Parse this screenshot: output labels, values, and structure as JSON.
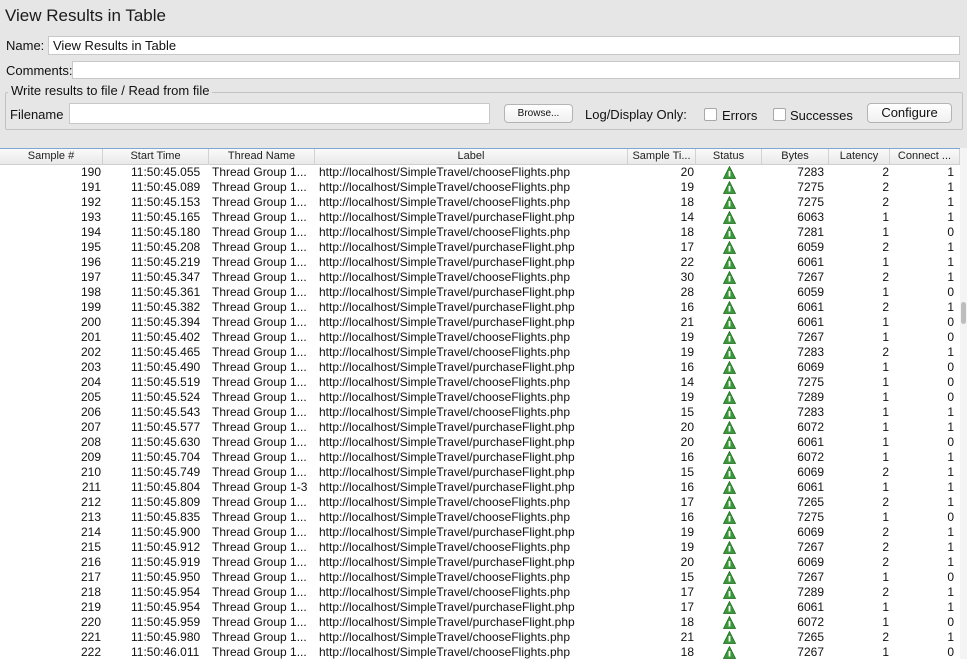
{
  "window": {
    "title": "View Results in Table"
  },
  "form": {
    "name_label": "Name:",
    "name_value": "View Results in Table",
    "comments_label": "Comments:",
    "comments_value": "",
    "group_title": "Write results to file / Read from file",
    "filename_label": "Filename",
    "filename_value": "",
    "browse_label": "Browse...",
    "logdisplay_label": "Log/Display Only:",
    "errors_label": "Errors",
    "successes_label": "Successes",
    "configure_label": "Configure"
  },
  "table": {
    "columns": [
      "Sample #",
      "Start Time",
      "Thread Name",
      "Label",
      "Sample Ti...",
      "Status",
      "Bytes",
      "Latency",
      "Connect ..."
    ],
    "status_icon": "success-triangle-icon",
    "status_color": "#3a9a3a",
    "rows": [
      [
        "190",
        "11:50:45.055",
        "Thread Group 1...",
        "http://localhost/SimpleTravel/chooseFlights.php",
        "20",
        "7283",
        "2",
        "1"
      ],
      [
        "191",
        "11:50:45.089",
        "Thread Group 1...",
        "http://localhost/SimpleTravel/chooseFlights.php",
        "19",
        "7275",
        "2",
        "1"
      ],
      [
        "192",
        "11:50:45.153",
        "Thread Group 1...",
        "http://localhost/SimpleTravel/chooseFlights.php",
        "18",
        "7275",
        "2",
        "1"
      ],
      [
        "193",
        "11:50:45.165",
        "Thread Group 1...",
        "http://localhost/SimpleTravel/purchaseFlight.php",
        "14",
        "6063",
        "1",
        "1"
      ],
      [
        "194",
        "11:50:45.180",
        "Thread Group 1...",
        "http://localhost/SimpleTravel/chooseFlights.php",
        "18",
        "7281",
        "1",
        "0"
      ],
      [
        "195",
        "11:50:45.208",
        "Thread Group 1...",
        "http://localhost/SimpleTravel/purchaseFlight.php",
        "17",
        "6059",
        "2",
        "1"
      ],
      [
        "196",
        "11:50:45.219",
        "Thread Group 1...",
        "http://localhost/SimpleTravel/purchaseFlight.php",
        "22",
        "6061",
        "1",
        "1"
      ],
      [
        "197",
        "11:50:45.347",
        "Thread Group 1...",
        "http://localhost/SimpleTravel/chooseFlights.php",
        "30",
        "7267",
        "2",
        "1"
      ],
      [
        "198",
        "11:50:45.361",
        "Thread Group 1...",
        "http://localhost/SimpleTravel/purchaseFlight.php",
        "28",
        "6059",
        "1",
        "0"
      ],
      [
        "199",
        "11:50:45.382",
        "Thread Group 1...",
        "http://localhost/SimpleTravel/purchaseFlight.php",
        "16",
        "6061",
        "2",
        "1"
      ],
      [
        "200",
        "11:50:45.394",
        "Thread Group 1...",
        "http://localhost/SimpleTravel/purchaseFlight.php",
        "21",
        "6061",
        "1",
        "0"
      ],
      [
        "201",
        "11:50:45.402",
        "Thread Group 1...",
        "http://localhost/SimpleTravel/chooseFlights.php",
        "19",
        "7267",
        "1",
        "0"
      ],
      [
        "202",
        "11:50:45.465",
        "Thread Group 1...",
        "http://localhost/SimpleTravel/chooseFlights.php",
        "19",
        "7283",
        "2",
        "1"
      ],
      [
        "203",
        "11:50:45.490",
        "Thread Group 1...",
        "http://localhost/SimpleTravel/purchaseFlight.php",
        "16",
        "6069",
        "1",
        "0"
      ],
      [
        "204",
        "11:50:45.519",
        "Thread Group 1...",
        "http://localhost/SimpleTravel/chooseFlights.php",
        "14",
        "7275",
        "1",
        "0"
      ],
      [
        "205",
        "11:50:45.524",
        "Thread Group 1...",
        "http://localhost/SimpleTravel/chooseFlights.php",
        "19",
        "7289",
        "1",
        "0"
      ],
      [
        "206",
        "11:50:45.543",
        "Thread Group 1...",
        "http://localhost/SimpleTravel/chooseFlights.php",
        "15",
        "7283",
        "1",
        "1"
      ],
      [
        "207",
        "11:50:45.577",
        "Thread Group 1...",
        "http://localhost/SimpleTravel/purchaseFlight.php",
        "20",
        "6072",
        "1",
        "1"
      ],
      [
        "208",
        "11:50:45.630",
        "Thread Group 1...",
        "http://localhost/SimpleTravel/purchaseFlight.php",
        "20",
        "6061",
        "1",
        "0"
      ],
      [
        "209",
        "11:50:45.704",
        "Thread Group 1...",
        "http://localhost/SimpleTravel/purchaseFlight.php",
        "16",
        "6072",
        "1",
        "1"
      ],
      [
        "210",
        "11:50:45.749",
        "Thread Group 1...",
        "http://localhost/SimpleTravel/purchaseFlight.php",
        "15",
        "6069",
        "2",
        "1"
      ],
      [
        "211",
        "11:50:45.804",
        "Thread Group 1-3",
        "http://localhost/SimpleTravel/purchaseFlight.php",
        "16",
        "6061",
        "1",
        "1"
      ],
      [
        "212",
        "11:50:45.809",
        "Thread Group 1...",
        "http://localhost/SimpleTravel/chooseFlights.php",
        "17",
        "7265",
        "2",
        "1"
      ],
      [
        "213",
        "11:50:45.835",
        "Thread Group 1...",
        "http://localhost/SimpleTravel/chooseFlights.php",
        "16",
        "7275",
        "1",
        "0"
      ],
      [
        "214",
        "11:50:45.900",
        "Thread Group 1...",
        "http://localhost/SimpleTravel/purchaseFlight.php",
        "19",
        "6069",
        "2",
        "1"
      ],
      [
        "215",
        "11:50:45.912",
        "Thread Group 1...",
        "http://localhost/SimpleTravel/chooseFlights.php",
        "19",
        "7267",
        "2",
        "1"
      ],
      [
        "216",
        "11:50:45.919",
        "Thread Group 1...",
        "http://localhost/SimpleTravel/purchaseFlight.php",
        "20",
        "6069",
        "2",
        "1"
      ],
      [
        "217",
        "11:50:45.950",
        "Thread Group 1...",
        "http://localhost/SimpleTravel/chooseFlights.php",
        "15",
        "7267",
        "1",
        "0"
      ],
      [
        "218",
        "11:50:45.954",
        "Thread Group 1...",
        "http://localhost/SimpleTravel/chooseFlights.php",
        "17",
        "7289",
        "2",
        "1"
      ],
      [
        "219",
        "11:50:45.954",
        "Thread Group 1...",
        "http://localhost/SimpleTravel/purchaseFlight.php",
        "17",
        "6061",
        "1",
        "1"
      ],
      [
        "220",
        "11:50:45.959",
        "Thread Group 1...",
        "http://localhost/SimpleTravel/purchaseFlight.php",
        "18",
        "6072",
        "1",
        "0"
      ],
      [
        "221",
        "11:50:45.980",
        "Thread Group 1...",
        "http://localhost/SimpleTravel/chooseFlights.php",
        "21",
        "7265",
        "2",
        "1"
      ],
      [
        "222",
        "11:50:46.011",
        "Thread Group 1...",
        "http://localhost/SimpleTravel/chooseFlights.php",
        "18",
        "7267",
        "1",
        "0"
      ]
    ]
  }
}
